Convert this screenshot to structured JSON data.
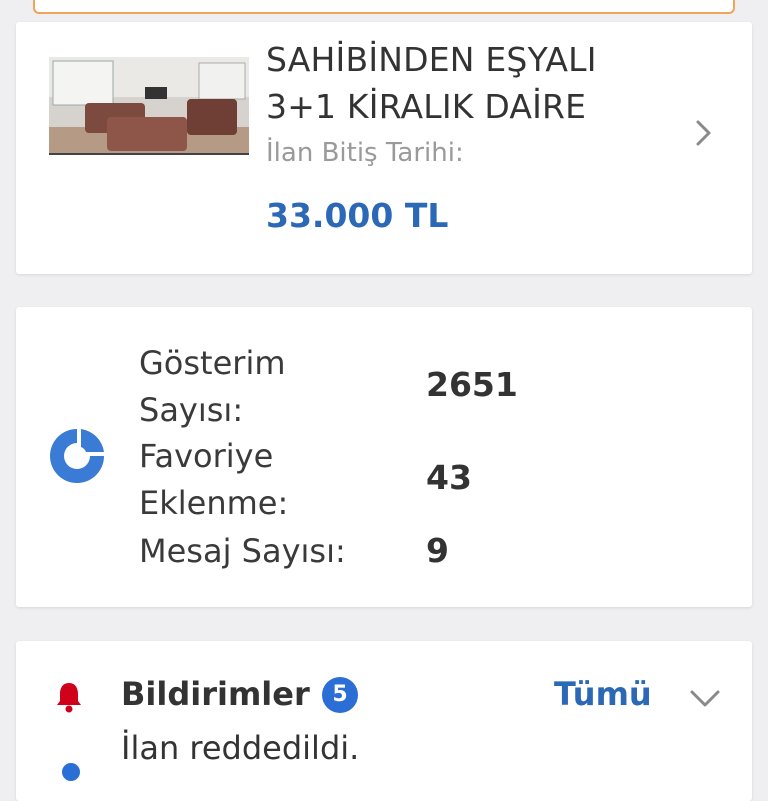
{
  "listing": {
    "title_line1": "SAHİBİNDEN EŞYALI",
    "title_line2": "3+1 KİRALIK DAİRE",
    "end_date_label": "İlan Bitiş Tarihi:",
    "price": "33.000 TL",
    "thumbnail_icon": "room-photo"
  },
  "stats": {
    "icon": "pie-chart-icon",
    "items": [
      {
        "label_line1": "Gösterim",
        "label_line2": "Sayısı:",
        "value": "2651"
      },
      {
        "label_line1": "Favoriye",
        "label_line2": "Eklenme:",
        "value": "43"
      },
      {
        "label_line1": "Mesaj Sayısı:",
        "label_line2": "",
        "value": "9"
      }
    ]
  },
  "notifications": {
    "title": "Bildirimler",
    "count": "5",
    "see_all_label": "Tümü",
    "first_item": "İlan reddedildi."
  },
  "colors": {
    "accent_blue": "#2b68b5",
    "bell_red": "#d0021b",
    "top_border_orange": "#f0a35a"
  }
}
